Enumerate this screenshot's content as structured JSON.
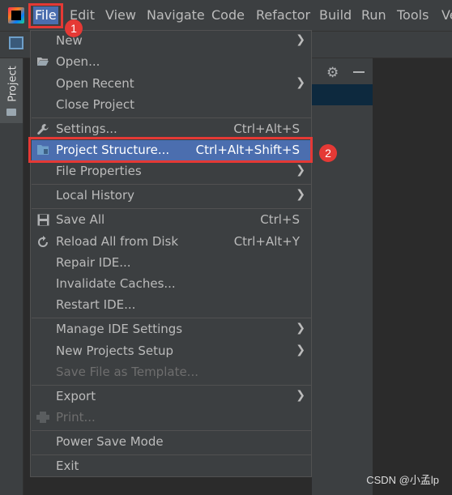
{
  "menubar": {
    "items": [
      "File",
      "Edit",
      "View",
      "Navigate",
      "Code",
      "Refactor",
      "Build",
      "Run",
      "Tools",
      "Ve"
    ]
  },
  "annotations": {
    "step1": "1",
    "step2": "2"
  },
  "sidebar": {
    "project_tab": "Project"
  },
  "file_menu": {
    "items": [
      {
        "label": "New",
        "shortcut": "",
        "submenu": true
      },
      {
        "label": "Open...",
        "shortcut": ""
      },
      {
        "label": "Open Recent",
        "shortcut": "",
        "submenu": true
      },
      {
        "label": "Close Project",
        "shortcut": ""
      },
      {
        "label": "Settings...",
        "shortcut": "Ctrl+Alt+S"
      },
      {
        "label": "Project Structure...",
        "shortcut": "Ctrl+Alt+Shift+S",
        "selected": true
      },
      {
        "label": "File Properties",
        "shortcut": "",
        "submenu": true
      },
      {
        "label": "Local History",
        "shortcut": "",
        "submenu": true
      },
      {
        "label": "Save All",
        "shortcut": "Ctrl+S"
      },
      {
        "label": "Reload All from Disk",
        "shortcut": "Ctrl+Alt+Y"
      },
      {
        "label": "Repair IDE...",
        "shortcut": ""
      },
      {
        "label": "Invalidate Caches...",
        "shortcut": ""
      },
      {
        "label": "Restart IDE...",
        "shortcut": ""
      },
      {
        "label": "Manage IDE Settings",
        "shortcut": "",
        "submenu": true
      },
      {
        "label": "New Projects Setup",
        "shortcut": "",
        "submenu": true
      },
      {
        "label": "Save File as Template...",
        "shortcut": "",
        "disabled": true
      },
      {
        "label": "Export",
        "shortcut": "",
        "submenu": true
      },
      {
        "label": "Print...",
        "shortcut": "",
        "disabled": true
      },
      {
        "label": "Power Save Mode",
        "shortcut": ""
      },
      {
        "label": "Exit",
        "shortcut": ""
      }
    ]
  },
  "watermark": "CSDN @小孟lp",
  "colors": {
    "selection": "#4b6eaf",
    "annotation_red": "#e53935",
    "background": "#3c3f41"
  }
}
